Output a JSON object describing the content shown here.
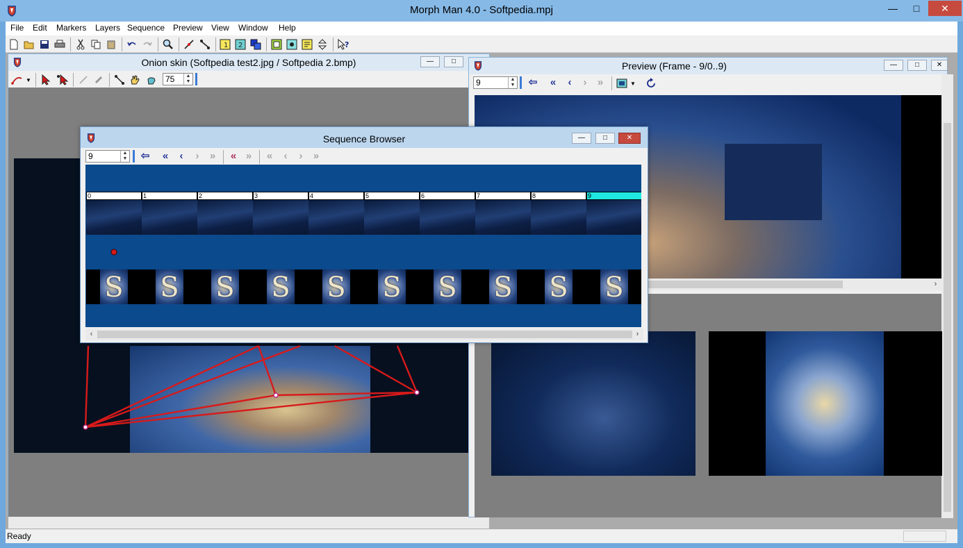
{
  "app": {
    "title": "Morph Man 4.0 - Softpedia.mpj"
  },
  "menu": [
    "File",
    "Edit",
    "Markers",
    "Layers",
    "Sequence",
    "Preview",
    "View",
    "Window",
    "Help"
  ],
  "onion": {
    "title": "Onion skin (Softpedia test2.jpg / Softpedia 2.bmp)",
    "zoom": "75"
  },
  "preview": {
    "title": "Preview (Frame - 9/0..9)",
    "frame": "9"
  },
  "sequence": {
    "title": "Sequence Browser",
    "frame": "9",
    "frames": [
      "0",
      "1",
      "2",
      "3",
      "4",
      "5",
      "6",
      "7",
      "8",
      "9"
    ],
    "current_frame": 9,
    "thumb_letter": "S"
  },
  "status": {
    "text": "Ready"
  },
  "colors": {
    "title_bar": "#86b9e6",
    "sequence_bg": "#0b4a8d",
    "current_frame": "#1ee8e0",
    "marker_line": "#d81a1a"
  }
}
